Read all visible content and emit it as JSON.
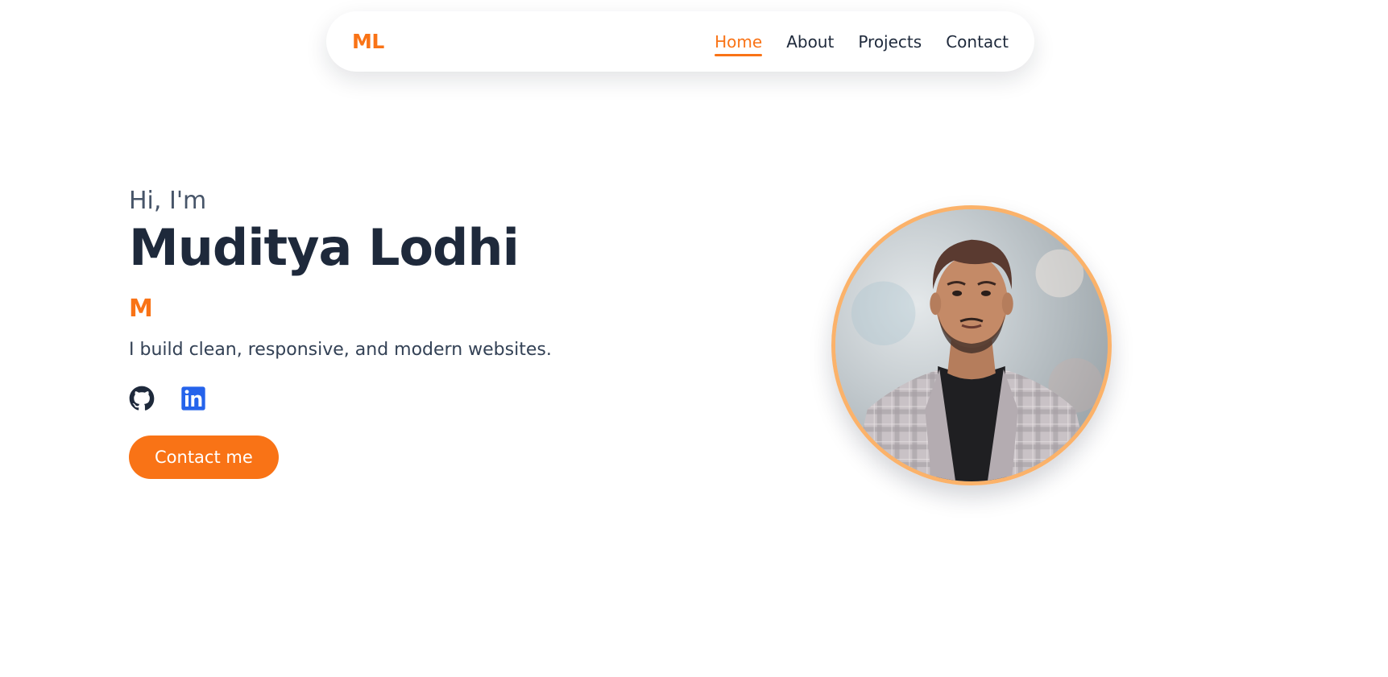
{
  "nav": {
    "logo": "ML",
    "links": [
      {
        "label": "Home",
        "active": true
      },
      {
        "label": "About",
        "active": false
      },
      {
        "label": "Projects",
        "active": false
      },
      {
        "label": "Contact",
        "active": false
      }
    ]
  },
  "hero": {
    "greeting": "Hi, I'm",
    "name": "Muditya Lodhi",
    "typed_text": "M",
    "tagline": "I build clean, responsive, and modern websites.",
    "socials": [
      {
        "icon": "github-icon"
      },
      {
        "icon": "linkedin-icon"
      }
    ],
    "cta_label": "Contact me"
  },
  "colors": {
    "accent": "#f97316",
    "text_dark": "#1e293b",
    "avatar_border": "#fbb26a",
    "linkedin": "#2563eb"
  }
}
